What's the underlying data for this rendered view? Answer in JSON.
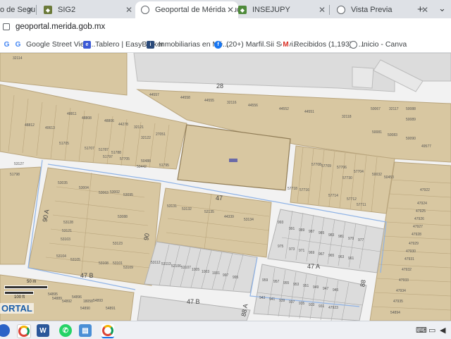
{
  "browser": {
    "tabs": [
      {
        "title": "o de Segu",
        "icon": "globe-icon",
        "active": false
      },
      {
        "title": "SIG2",
        "icon": "seal-icon",
        "active": false
      },
      {
        "title": "Geoportal de Mérida Yucatá",
        "icon": "globe-icon",
        "active": true
      },
      {
        "title": "INSEJUPY",
        "icon": "seal-icon",
        "active": false
      },
      {
        "title": "Vista Previa",
        "icon": "globe-icon",
        "active": false
      }
    ],
    "new_tab_label": "+",
    "menu_label": "⌄",
    "url": "geoportal.merida.gob.mx",
    "bookmarks": [
      {
        "label": "",
        "icon": "google-icon"
      },
      {
        "label": "Google Street View...",
        "icon": "google-icon"
      },
      {
        "label": "Tablero | EasyBroker",
        "icon": "easybroker-icon"
      },
      {
        "label": "Inmobiliarias en Mé...",
        "icon": "inmobiliarias-icon"
      },
      {
        "label": "(20+) Marfil.Sii Servi...",
        "icon": "facebook-icon"
      },
      {
        "label": "Recibidos (1,193) - ...",
        "icon": "gmail-icon"
      },
      {
        "label": "Inicio - Canva",
        "icon": "canva-icon"
      }
    ]
  },
  "map": {
    "streets": [
      "28",
      "47",
      "47 A",
      "47 B",
      "47 B",
      "90 A",
      "90",
      "88",
      "88 A"
    ],
    "parcels": [
      "32114",
      "44557",
      "44558",
      "44555",
      "32116",
      "44556",
      "44552",
      "44551",
      "32118",
      "50067",
      "50081",
      "32117",
      "50088",
      "48811",
      "48812",
      "48808",
      "48806",
      "40613",
      "44278",
      "32121",
      "32122",
      "27051",
      "50089",
      "50083",
      "50090",
      "49577",
      "51705",
      "51707",
      "51787",
      "51788",
      "50488",
      "50442",
      "51795",
      "57708",
      "57709",
      "57706",
      "57704",
      "50032",
      "50453",
      "53035",
      "53004",
      "53063",
      "53002",
      "53095",
      "53088",
      "53131",
      "53132",
      "52135",
      "44339",
      "53134",
      "53128",
      "53121",
      "53123",
      "53103",
      "53104",
      "53101",
      "53105",
      "53108",
      "53109",
      "53112",
      "53113",
      "52106",
      "53107",
      "1005",
      "1003",
      "1001",
      "997",
      "995",
      "993",
      "991",
      "989",
      "987",
      "985",
      "983",
      "981",
      "979",
      "977",
      "975",
      "973",
      "971",
      "969",
      "967",
      "965",
      "963",
      "961",
      "959",
      "957",
      "955",
      "953",
      "951",
      "949",
      "947",
      "945",
      "943",
      "941",
      "939",
      "937",
      "935",
      "933",
      "931",
      "47923",
      "47922",
      "47924",
      "47925",
      "47926",
      "47927",
      "47928",
      "47929",
      "47930",
      "47931",
      "47932",
      "47933",
      "47934",
      "47935",
      "54894",
      "54895",
      "54896",
      "54893",
      "54889",
      "54890",
      "54891",
      "54892",
      "18058",
      "53127",
      "51798",
      "51797",
      "57705",
      "57730",
      "57718",
      "57716",
      "57714",
      "57712",
      "57711"
    ],
    "scale_metric": "50 m",
    "scale_imperial": "100 ft",
    "portal_label": "ORTAL"
  },
  "taskbar": {
    "apps": [
      "windows-icon",
      "chrome-icon",
      "word-icon",
      "whatsapp-icon",
      "files-icon",
      "chrome-active-icon"
    ]
  },
  "colors": {
    "parcel": "#d8c7a1",
    "parcel_stroke": "#b9a57d",
    "street": "#f7f7f7",
    "block_outline": "#8fb3e6",
    "grey_block": "#dcdcdc"
  }
}
